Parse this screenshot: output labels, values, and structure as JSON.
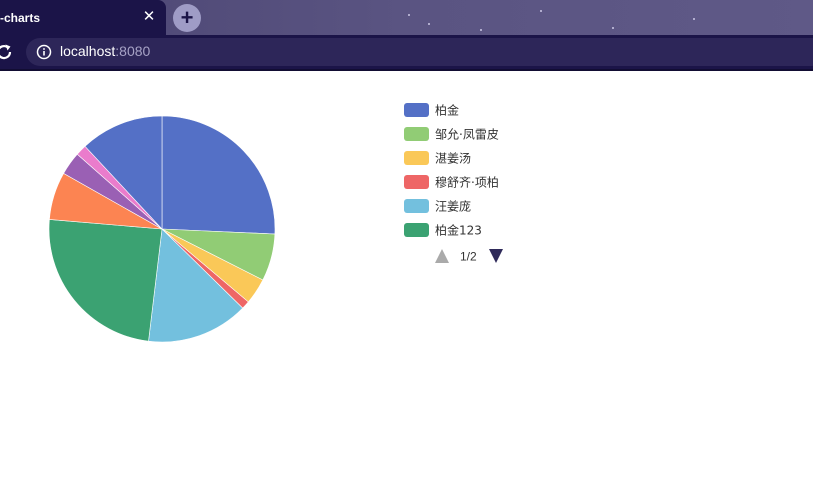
{
  "browser": {
    "tab_title": "-charts",
    "tab_close_label": "✕",
    "new_tab_label": "+",
    "url_host": "localhost",
    "url_port": ":8080",
    "colors": {
      "tabbar": "#4b4572",
      "tab_active": "#1b1448",
      "toolbar": "#1b1448",
      "urlbox": "#2d2659"
    }
  },
  "chart_data": {
    "type": "pie",
    "slices": [
      {
        "name": "柏金",
        "value": 26.3,
        "color": "#5470c6"
      },
      {
        "name": "邹允·凤雷皮",
        "value": 6.9,
        "color": "#91cc75"
      },
      {
        "name": "湛姜汤",
        "value": 3.8,
        "color": "#fac858"
      },
      {
        "name": "穆舒齐·项柏",
        "value": 1.2,
        "color": "#ee6666"
      },
      {
        "name": "汪姜庞",
        "value": 14.9,
        "color": "#73c0de"
      },
      {
        "name": "柏金123",
        "value": 25.0,
        "color": "#3ba272"
      },
      {
        "name": "",
        "value": 7.0,
        "color": "#fc8452"
      },
      {
        "name": "",
        "value": 3.4,
        "color": "#9a60b4"
      },
      {
        "name": "",
        "value": 1.6,
        "color": "#ea7ccc"
      },
      {
        "name": "",
        "value": 12.2,
        "color": "#5470c6"
      }
    ],
    "legend": {
      "placement": "right",
      "visible_items": 6,
      "pager": {
        "current": 1,
        "total": 2,
        "label": "1/2",
        "prev_color": "#aaaaaa",
        "next_color": "#2f2a5a"
      }
    }
  }
}
